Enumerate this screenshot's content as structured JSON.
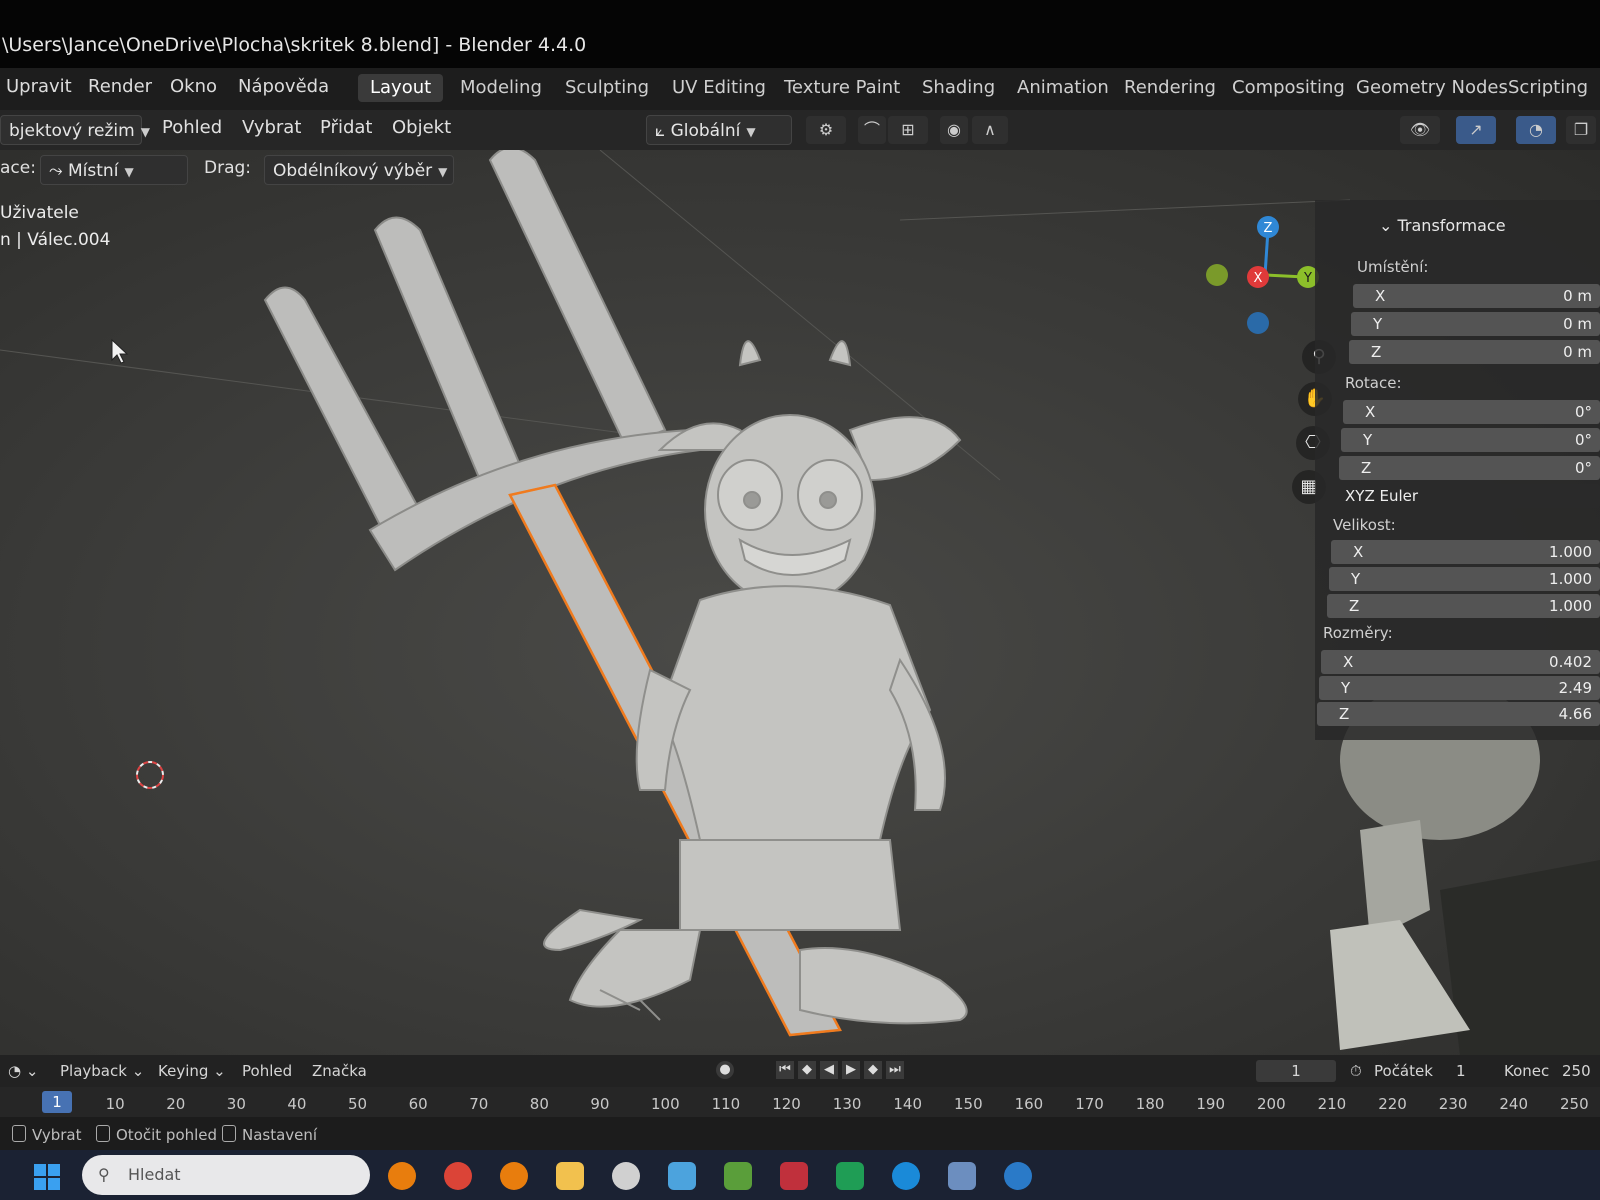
{
  "window": {
    "title": "\\Users\\Jance\\OneDrive\\Plocha\\skritek 8.blend] - Blender 4.4.0"
  },
  "menubar": {
    "items": [
      "Upravit",
      "Render",
      "Okno",
      "Nápověda"
    ],
    "workspace_tabs": [
      "Layout",
      "Modeling",
      "Sculpting",
      "UV Editing",
      "Texture Paint",
      "Shading",
      "Animation",
      "Rendering",
      "Compositing",
      "Geometry Nodes",
      "Scripting"
    ],
    "active_tab": "Layout"
  },
  "header": {
    "mode": "bjektový režim",
    "menus": [
      "Pohled",
      "Vybrat",
      "Přidat",
      "Objekt"
    ],
    "orientation": "Globální",
    "pivot_label": "ace:",
    "pivot_value": "Místní",
    "drag_label": "Drag:",
    "drag_value": "Obdélníkový výběr"
  },
  "viewport": {
    "view_name": "Uživatele",
    "object_name": "n | Válec.004"
  },
  "npanel": {
    "section": "Transformace",
    "location_label": "Umístění:",
    "location": [
      {
        "axis": "X",
        "value": "0 m"
      },
      {
        "axis": "Y",
        "value": "0 m"
      },
      {
        "axis": "Z",
        "value": "0 m"
      }
    ],
    "rotation_label": "Rotace:",
    "rotation": [
      {
        "axis": "X",
        "value": "0°"
      },
      {
        "axis": "Y",
        "value": "0°"
      },
      {
        "axis": "Z",
        "value": "0°"
      }
    ],
    "rotation_mode": "XYZ Euler",
    "scale_label": "Velikost:",
    "scale": [
      {
        "axis": "X",
        "value": "1.000"
      },
      {
        "axis": "Y",
        "value": "1.000"
      },
      {
        "axis": "Z",
        "value": "1.000"
      }
    ],
    "dimensions_label": "Rozměry:",
    "dimensions": [
      {
        "axis": "X",
        "value": "0.402"
      },
      {
        "axis": "Y",
        "value": "2.49"
      },
      {
        "axis": "Z",
        "value": "4.66"
      }
    ]
  },
  "gizmo": {
    "z": "Z",
    "y": "Y",
    "x": "X"
  },
  "timeline": {
    "menus": [
      "Playback",
      "Keying",
      "Pohled",
      "Značka"
    ],
    "current_frame": "1",
    "start_label": "Počátek",
    "start_value": "1",
    "end_label": "Konec",
    "end_value": "250",
    "ticks": [
      "1",
      "10",
      "20",
      "30",
      "40",
      "50",
      "60",
      "70",
      "80",
      "90",
      "100",
      "110",
      "120",
      "130",
      "140",
      "150",
      "160",
      "170",
      "180",
      "190",
      "200",
      "210",
      "220",
      "230",
      "240",
      "250"
    ]
  },
  "statusbar": {
    "items": [
      "Vybrat",
      "Otočit pohled",
      "Nastavení"
    ]
  },
  "taskbar": {
    "search_placeholder": "Hledat"
  },
  "colors": {
    "accent": "#4772b3",
    "selection": "#f07b1e",
    "axis_x": "#e03a3a",
    "axis_y": "#8cbf2a",
    "axis_z": "#2f88d6"
  }
}
